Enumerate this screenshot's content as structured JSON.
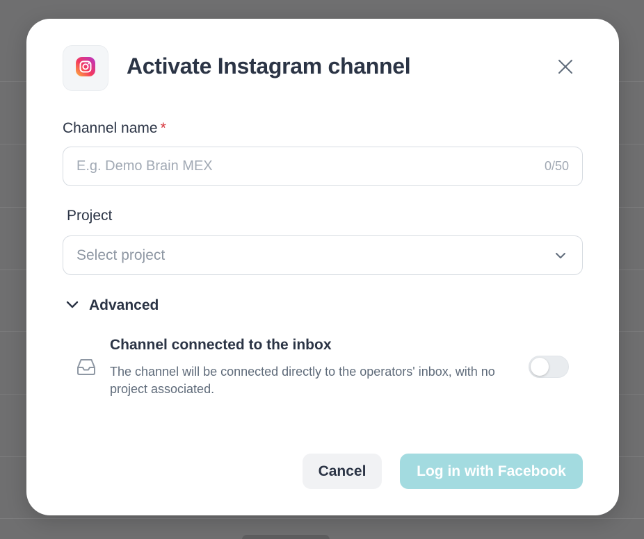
{
  "modal": {
    "title": "Activate Instagram channel",
    "icon": "instagram-icon",
    "close_icon": "close-icon"
  },
  "channel_name": {
    "label": "Channel name",
    "required_mark": "*",
    "placeholder": "E.g. Demo Brain MEX",
    "value": "",
    "counter": "0/50"
  },
  "project": {
    "label": "Project",
    "placeholder": "Select project",
    "icon": "chevron-down-icon"
  },
  "advanced": {
    "label": "Advanced",
    "icon": "chevron-down-icon",
    "expanded": true
  },
  "inbox_option": {
    "icon": "inbox-icon",
    "title": "Channel connected to the inbox",
    "description": "The channel will be connected directly to the operators' inbox, with no project associated.",
    "enabled": false
  },
  "actions": {
    "cancel_label": "Cancel",
    "facebook_label": "Log in with Facebook"
  },
  "colors": {
    "primary_disabled": "#a3dbe0",
    "text": "#2b3445",
    "required": "#d6333a",
    "backdrop": "#6f6f70"
  }
}
